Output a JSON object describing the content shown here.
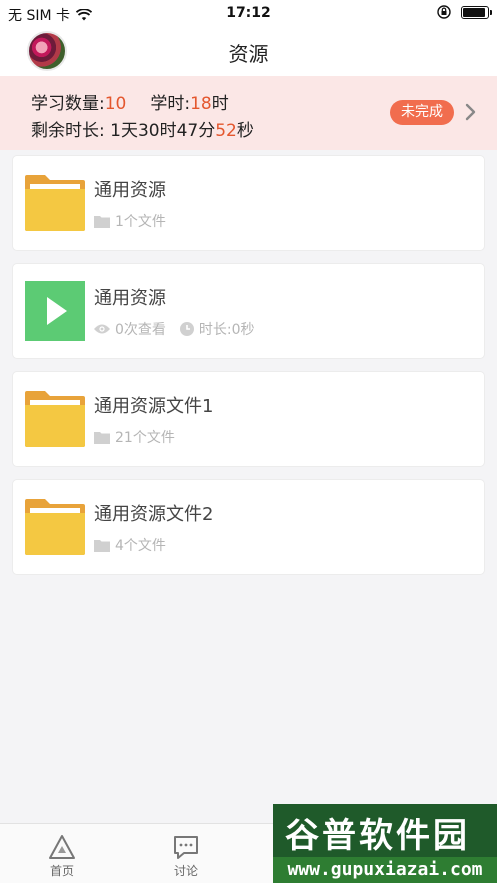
{
  "status_bar": {
    "carrier": "无 SIM 卡",
    "time": "17:12",
    "battery_level": 0.92
  },
  "nav": {
    "title": "资源"
  },
  "summary": {
    "study_count_label": "学习数量:",
    "study_count_value": "10",
    "study_hours_label": "学时:",
    "study_hours_value": "18",
    "study_hours_unit": "时",
    "remaining_label": "剩余时长: 1天30时47分",
    "remaining_seconds": "52",
    "remaining_seconds_unit": "秒",
    "status_badge": "未完成",
    "colors": {
      "highlight": "#e4572e",
      "badge": "#f16d4e",
      "banner_bg": "#fbe7e6"
    }
  },
  "resources": [
    {
      "type": "folder",
      "icon": "folder-icon",
      "title": "通用资源",
      "meta": [
        "1个文件"
      ]
    },
    {
      "type": "video",
      "icon": "play-icon",
      "title": "通用资源",
      "views": "0次查看",
      "duration": "时长:0秒"
    },
    {
      "type": "folder",
      "icon": "folder-icon",
      "title": "通用资源文件1",
      "meta": [
        "21个文件"
      ]
    },
    {
      "type": "folder",
      "icon": "folder-icon",
      "title": "通用资源文件2",
      "meta": [
        "4个文件"
      ]
    }
  ],
  "tab_bar": {
    "items": [
      {
        "label": "首页",
        "icon": "home-triangle-icon"
      },
      {
        "label": "讨论",
        "icon": "chat-icon"
      }
    ]
  },
  "watermark": {
    "text": "谷普软件园",
    "url": "www.gupuxiazai.com"
  }
}
